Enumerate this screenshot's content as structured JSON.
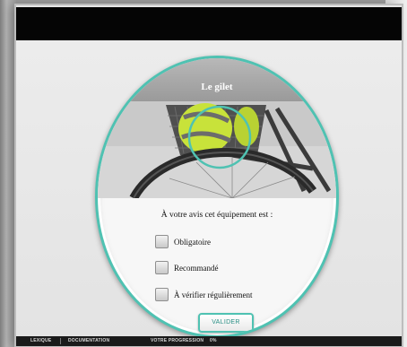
{
  "card": {
    "title": "Le gilet",
    "question": "À votre avis cet équipement est :",
    "options": [
      "Obligatoire",
      "Recommandé",
      "À vérifier régulièrement"
    ],
    "submit_label": "VALIDER"
  },
  "footer": {
    "lexicon": "LEXIQUE",
    "documentation": "DOCUMENTATION",
    "progress_label": "VOTRE PROGRESSION",
    "progress_value": "0%"
  },
  "colors": {
    "accent": "#4fc2b2",
    "topbar": "#050505",
    "vest": "#c8e23a"
  },
  "icons": {
    "option_checkbox": "checkbox-icon",
    "photo": "bicycle-basket-vest-photo"
  }
}
